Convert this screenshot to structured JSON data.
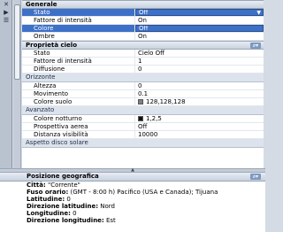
{
  "toolbar": {
    "close_glyph": "✕",
    "autohide_glyph": "▶",
    "menu_glyph": "☰"
  },
  "sections": {
    "generale": {
      "title": "Generale",
      "rows": [
        {
          "name": "Stato",
          "value": "Off"
        },
        {
          "name": "Fattore di intensità",
          "value": "On"
        },
        {
          "name": "Colore",
          "value": "Off"
        },
        {
          "name": "Ombre",
          "value": "On"
        }
      ]
    },
    "cielo": {
      "title": "Proprietà cielo",
      "rows": [
        {
          "name": "Stato",
          "value": "Cielo Off"
        },
        {
          "name": "Fattore di intensità",
          "value": "1"
        },
        {
          "name": "Diffusione",
          "value": "0"
        }
      ]
    },
    "orizzonte": {
      "title": "Orizzonte",
      "rows": [
        {
          "name": "Altezza",
          "value": "0"
        },
        {
          "name": "Movimento",
          "value": "0.1"
        },
        {
          "name": "Colore suolo",
          "value": "128,128,128"
        }
      ]
    },
    "avanzato": {
      "title": "Avanzato",
      "rows": [
        {
          "name": "Colore notturno",
          "value": "1,2,5"
        },
        {
          "name": "Prospettiva aerea",
          "value": "Off"
        },
        {
          "name": "Distanza visibilità",
          "value": "10000"
        }
      ]
    },
    "disco": {
      "title": "Aspetto disco solare"
    }
  },
  "geo": {
    "title": "Posizione geografica",
    "lines": [
      {
        "label": "Città:",
        "value": " \"Corrente\""
      },
      {
        "label": "Fuso orario:",
        "value": " (GMT - 8:00 h) Pacifico (USA e Canada); Tijuana"
      },
      {
        "label": "Latitudine:",
        "value": " 0"
      },
      {
        "label": "Direzione latitudine:",
        "value": " Nord"
      },
      {
        "label": "Longitudine:",
        "value": " 0"
      },
      {
        "label": "Direzione longitudine:",
        "value": " Est"
      }
    ]
  },
  "colors": {
    "selection": "#3d71c8",
    "section_header": "#c8d1de"
  }
}
